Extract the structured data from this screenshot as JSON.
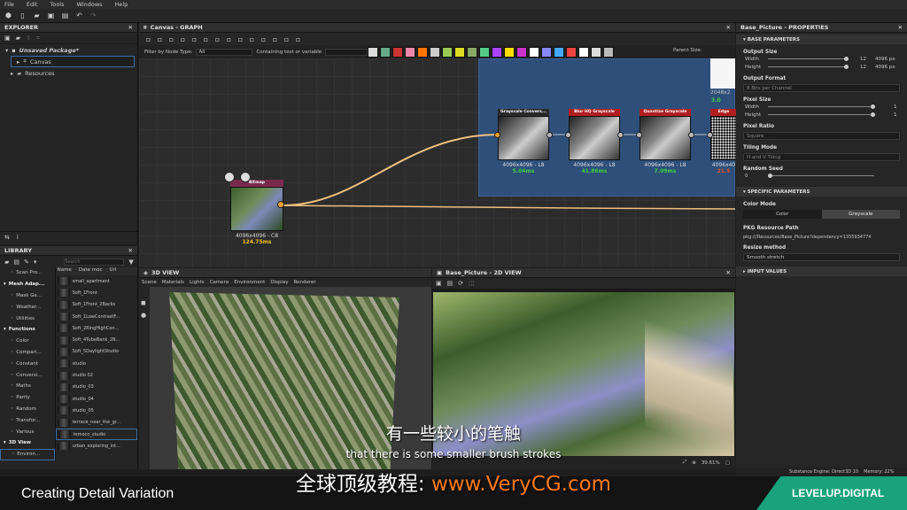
{
  "menu": [
    "File",
    "Edit",
    "Tools",
    "Windows",
    "Help"
  ],
  "explorer": {
    "title": "EXPLORER",
    "package": "Unsaved Package*",
    "items": [
      "Canvas",
      "Resources"
    ]
  },
  "library": {
    "title": "LIBRARY",
    "search_placeholder": "Search",
    "columns": [
      "Name",
      "Date moc",
      "Url"
    ],
    "categories": [
      "Scan Pro...",
      "Mesh Adap...",
      "Mask Ge...",
      "Weather...",
      "Utilities",
      "Functions",
      "Color",
      "Compari...",
      "Constant",
      "Conversi...",
      "Maths",
      "Parity",
      "Random",
      "Transfor...",
      "Various",
      "3D View",
      "Environ..."
    ],
    "items": [
      "small_apartment",
      "Soft_1Front",
      "Soft_1Front_2Backs",
      "Soft_1LowContrastF...",
      "Soft_2RingHighCon...",
      "Soft_4TubeBank_2B...",
      "Soft_5DaylightStudio",
      "studio",
      "studio 02",
      "studio_03",
      "studio_04",
      "studio_05",
      "terrace_near_the_gr...",
      "tomoco_studio",
      "urban_exploring_int..."
    ]
  },
  "graph": {
    "title": "Canvas - GRAPH",
    "filter_label": "Filter by Node Type:",
    "filter_value": "All",
    "text_filter_label": "Containing text or variable",
    "parent_size_label": "Parent Size:",
    "source_node": {
      "title": "Bitmap",
      "size": "4096x4096 - C8",
      "time": "124.75ms"
    },
    "nodes": [
      {
        "title": "Grayscale Convers...",
        "size": "4096x4096 - L8",
        "time": "5.04ms",
        "color": "#2a2a2a"
      },
      {
        "title": "Blur HQ Grayscale",
        "size": "4096x4096 - L8",
        "time": "41.86ms",
        "color": "#b01e1e"
      },
      {
        "title": "Quantize Grayscale",
        "size": "4096x4096 - L8",
        "time": "7.09ms",
        "color": "#b01e1e"
      },
      {
        "title": "Edge",
        "size": "4096x40",
        "time": "21.5",
        "color": "#b01e1e"
      }
    ],
    "top_node": {
      "size": "2048x2",
      "time": "3.0"
    }
  },
  "properties": {
    "title": "Base_Picture - PROPERTIES",
    "base_section": "BASE PARAMETERS",
    "output_size_label": "Output Size",
    "width_label": "Width",
    "height_label": "Height",
    "size_exp": "12",
    "width_value": "4096 px",
    "height_value": "4096 px",
    "output_format_label": "Output Format",
    "output_format_value": "8 Bits per Channel",
    "pixel_size_label": "Pixel Size",
    "pixel_w": "1",
    "pixel_h": "1",
    "pixel_ratio_label": "Pixel Ratio",
    "pixel_ratio_value": "Square",
    "tiling_label": "Tiling Mode",
    "tiling_value": "H and V Tiling",
    "seed_label": "Random Seed",
    "seed_value": "0",
    "specific_section": "SPECIFIC PARAMETERS",
    "color_mode_label": "Color Mode",
    "color_mode_options": [
      "Color",
      "Grayscale"
    ],
    "pkg_label": "PKG Resource Path",
    "pkg_value": "pkg:///Resources/Base_Picture?dependency=1355934774",
    "resize_label": "Resize method",
    "resize_value": "Smooth stretch",
    "input_section": "INPUT VALUES"
  },
  "view3d": {
    "title": "3D VIEW",
    "menu": [
      "Scene",
      "Materials",
      "Lights",
      "Camera",
      "Environment",
      "Display",
      "Renderer"
    ]
  },
  "view2d": {
    "title": "Base_Picture - 2D VIEW",
    "zoom": "39.61%"
  },
  "status": {
    "engine": "Substance Engine: Direct3D 10",
    "memory": "Memory: 22%"
  },
  "subtitles": {
    "cn": "有一些较小的笔触",
    "en": "that there is some smaller brush strokes",
    "promo_prefix": "全球顶级教程: ",
    "promo_url": "www.VeryCG.com"
  },
  "banner": {
    "lesson": "Creating Detail Variation",
    "brand": "LEVELUP.DIGITAL"
  },
  "colors": {
    "accent": "#f0a030",
    "frame": "#2e4f7a",
    "time_green": "#3fd13f",
    "time_yellow": "#f0c020",
    "brand_green": "#1aa37a"
  }
}
